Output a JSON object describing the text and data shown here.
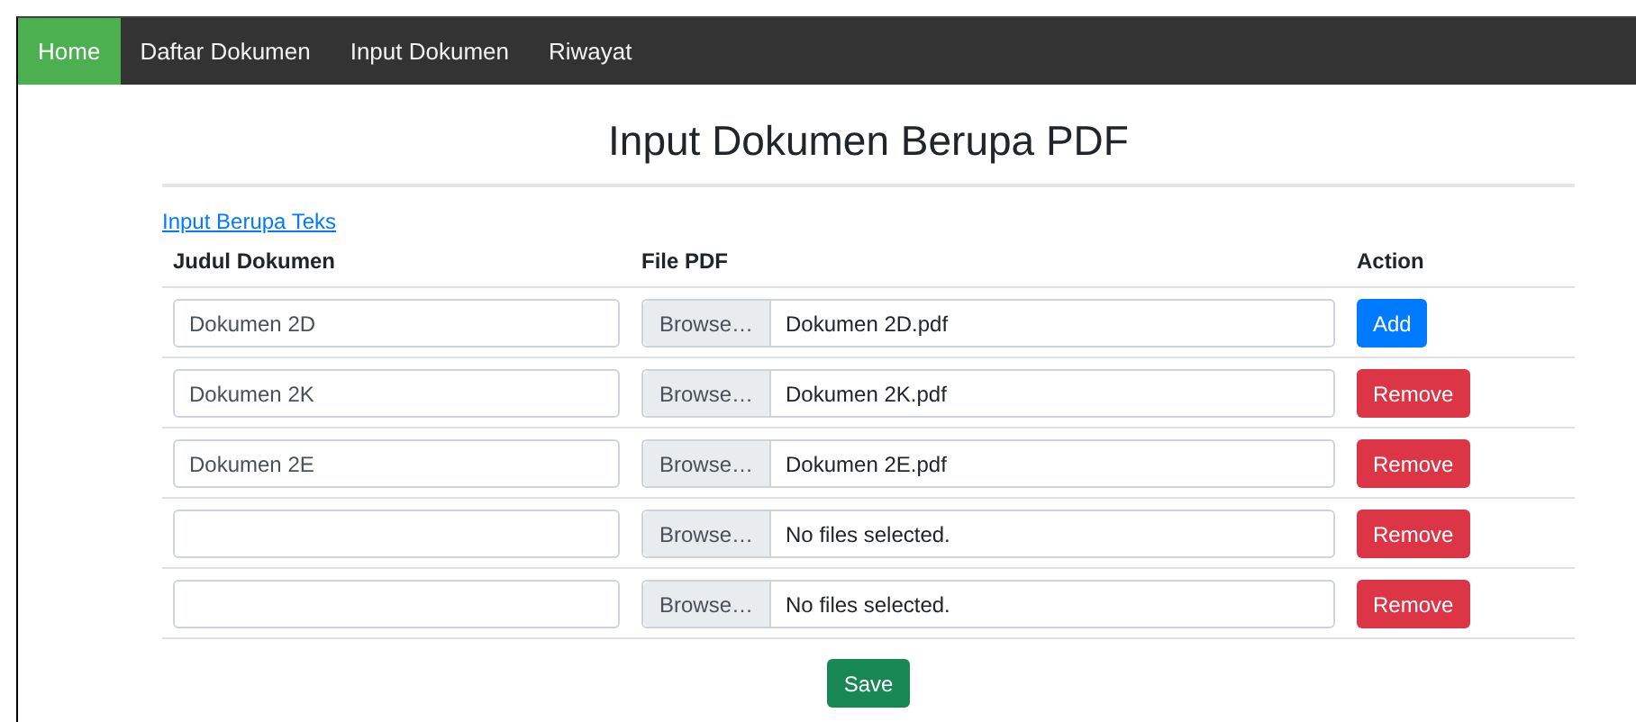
{
  "nav": {
    "items": [
      {
        "label": "Home",
        "selected": true
      },
      {
        "label": "Daftar Dokumen",
        "selected": false
      },
      {
        "label": "Input Dokumen",
        "selected": false
      },
      {
        "label": "Riwayat",
        "selected": false
      }
    ]
  },
  "heading": "Input Dokumen Berupa PDF",
  "text_link": "Input Berupa Teks",
  "table": {
    "columns": [
      "Judul Dokumen",
      "File PDF",
      "Action"
    ],
    "rows": [
      {
        "title": "Dokumen 2D",
        "browse": "Browse…",
        "file": "Dokumen 2D.pdf",
        "action": {
          "kind": "add",
          "label": "Add"
        }
      },
      {
        "title": "Dokumen 2K",
        "browse": "Browse…",
        "file": "Dokumen 2K.pdf",
        "action": {
          "kind": "remove",
          "label": "Remove"
        }
      },
      {
        "title": "Dokumen 2E",
        "browse": "Browse…",
        "file": "Dokumen 2E.pdf",
        "action": {
          "kind": "remove",
          "label": "Remove"
        }
      },
      {
        "browse": "Browse…",
        "file": "No files selected.",
        "action": {
          "kind": "remove",
          "label": "Remove"
        }
      },
      {
        "browse": "Browse…",
        "file": "No files selected.",
        "action": {
          "kind": "remove",
          "label": "Remove"
        }
      }
    ]
  },
  "save_button": "Save"
}
